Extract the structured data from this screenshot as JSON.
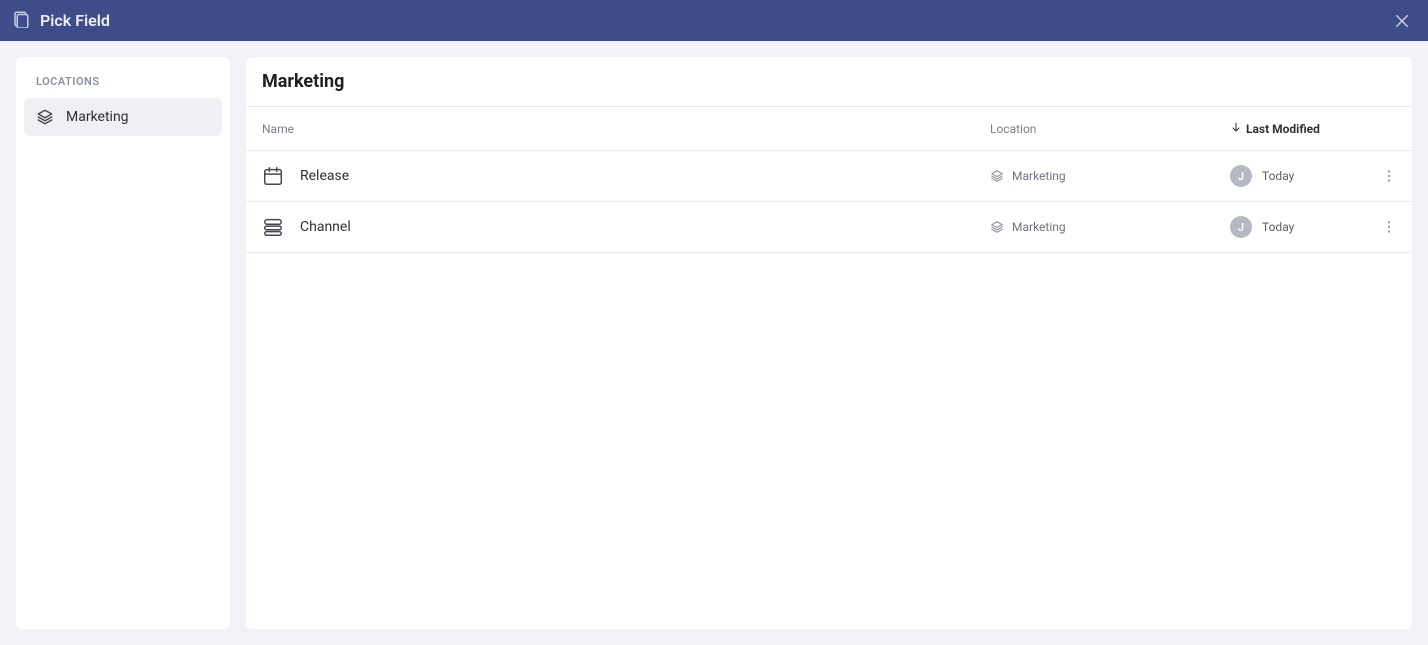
{
  "header": {
    "title": "Pick Field"
  },
  "sidebar": {
    "heading": "LOCATIONS",
    "items": [
      {
        "label": "Marketing",
        "active": true
      }
    ]
  },
  "main": {
    "title": "Marketing",
    "columns": {
      "name": "Name",
      "location": "Location",
      "modified": "Last Modified"
    },
    "rows": [
      {
        "icon": "calendar",
        "name": "Release",
        "location": "Marketing",
        "avatar": "J",
        "modified": "Today"
      },
      {
        "icon": "list",
        "name": "Channel",
        "location": "Marketing",
        "avatar": "J",
        "modified": "Today"
      }
    ]
  }
}
